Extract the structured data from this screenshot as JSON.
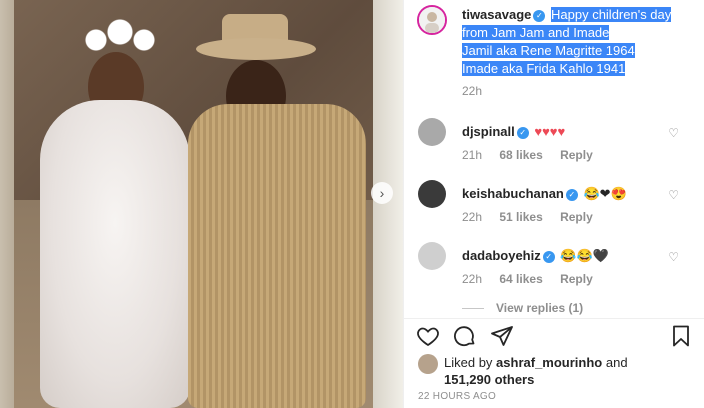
{
  "post": {
    "caption_user": "tiwasavage",
    "caption_lines": [
      "Happy children's day",
      "from Jam Jam and Imade",
      "Jamil aka Rene Magritte 1964",
      "Imade aka Frida Kahlo 1941"
    ],
    "caption_time": "22h"
  },
  "comments": [
    {
      "user": "djspinall",
      "text": "♥♥♥♥",
      "time": "21h",
      "likes": "68 likes",
      "reply": "Reply"
    },
    {
      "user": "keishabuchanan",
      "text": "😂❤😍",
      "time": "22h",
      "likes": "51 likes",
      "reply": "Reply"
    },
    {
      "user": "dadaboyehiz",
      "text": "😂😂🖤",
      "time": "22h",
      "likes": "64 likes",
      "reply": "Reply"
    }
  ],
  "view_replies": "View replies (1)",
  "likes": {
    "liked_by_prefix": "Liked by",
    "liked_by_user": "ashraf_mourinho",
    "and": "and",
    "others": "151,290 others"
  },
  "posted_ago": "22 HOURS AGO",
  "colors": {
    "highlight": "#3b86f7",
    "heart_red": "#ed4956",
    "verified": "#3897f0"
  }
}
